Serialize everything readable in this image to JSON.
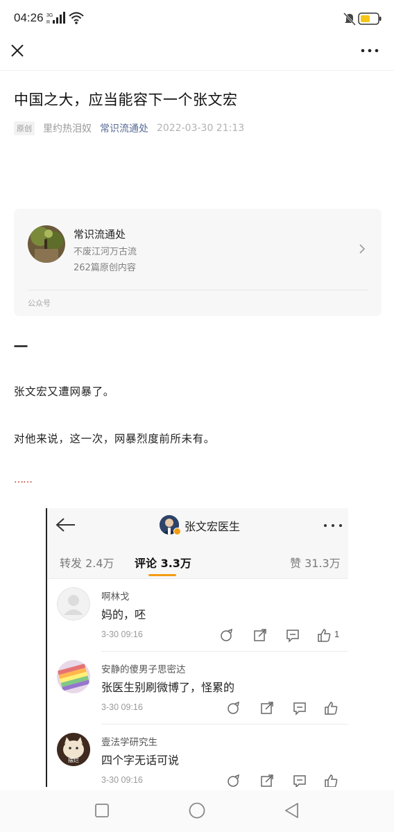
{
  "status_bar": {
    "time": "04:26",
    "network": "3G",
    "signal_icon": "signal-bars-icon",
    "wifi_icon": "wifi-icon",
    "mute_icon": "mute-bell-icon",
    "battery_color": "#f5c518"
  },
  "nav": {
    "close_icon": "close-icon",
    "more_icon": "more-dots-icon"
  },
  "article": {
    "title": "中国之大，应当能容下一个张文宏",
    "original_badge": "原创",
    "author": "里约热泪奴",
    "account_link": "常识流通处",
    "date": "2022-03-30 21:13"
  },
  "account_card": {
    "name": "常识流通处",
    "description": "不废江河万古流",
    "article_count": "262篇原创内容",
    "type_label": "公众号"
  },
  "body": {
    "section_mark": "一",
    "paragraph_1": "张文宏又遭网暴了。",
    "paragraph_2": "对他来说，这一次，网暴烈度前所未有。",
    "ellipsis": "……"
  },
  "embed": {
    "title": "张文宏医生",
    "tabs": {
      "repost": "转发 2.4万",
      "comment": "评论 3.3万",
      "like": "赞 31.3万"
    },
    "accent_color": "#f39c12",
    "comments": [
      {
        "name": "啊林戈",
        "text": "妈的，呸",
        "time": "3-30 09:16",
        "like_count": "1"
      },
      {
        "name": "安静的傻男子思密达",
        "text": "张医生别刷微博了，怪累的",
        "time": "3-30 09:16",
        "like_count": ""
      },
      {
        "name": "壹法学研究生",
        "text": "四个字无话可说",
        "time": "3-30 09:16",
        "like_count": "",
        "avatar_label": "摆烂"
      }
    ]
  },
  "system_nav": {
    "recent_icon": "square-icon",
    "home_icon": "circle-icon",
    "back_icon": "triangle-back-icon"
  }
}
